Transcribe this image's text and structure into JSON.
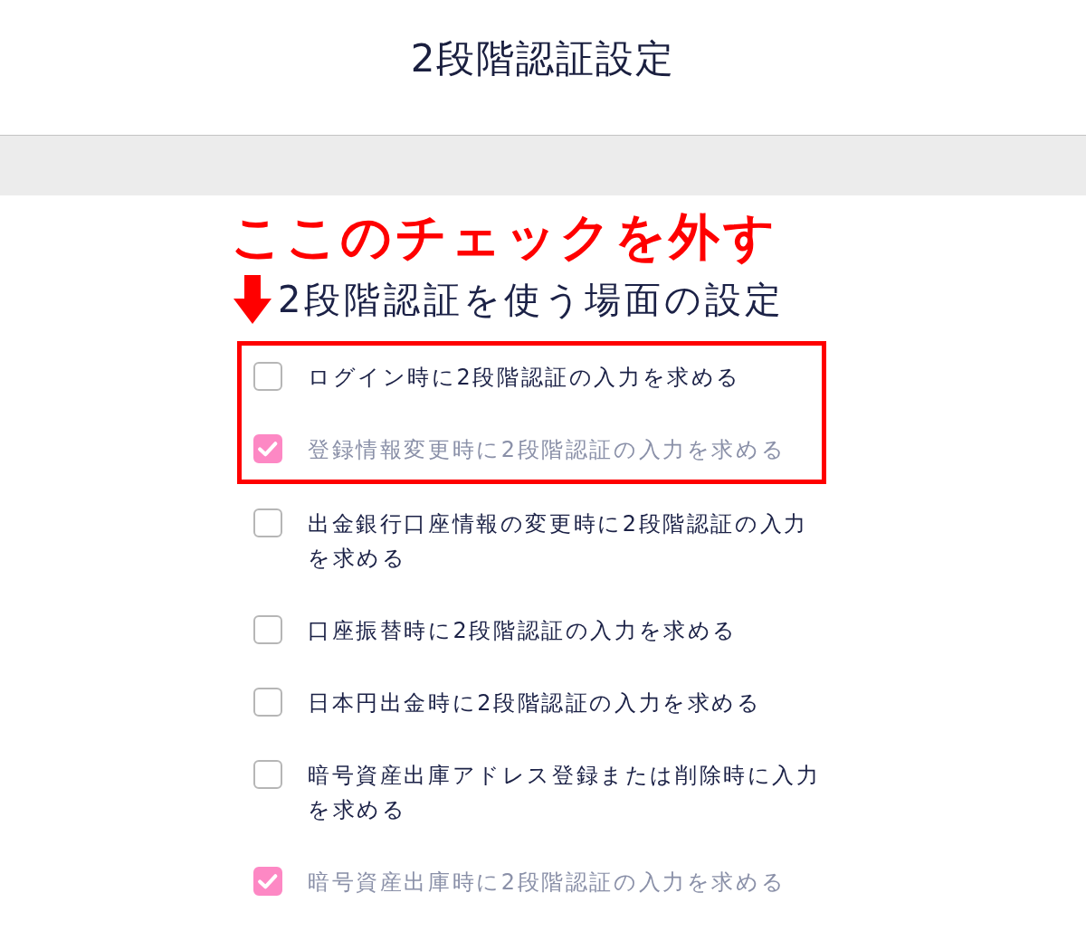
{
  "header": {
    "title": "2段階認証設定"
  },
  "annotation": {
    "text": "ここのチェックを外す"
  },
  "section": {
    "heading": "2段階認証を使う場面の設定",
    "items": [
      {
        "label": "ログイン時に2段階認証の入力を求める",
        "checked": false,
        "highlighted": true
      },
      {
        "label": "登録情報変更時に2段階認証の入力を求める",
        "checked": true,
        "highlighted": true
      },
      {
        "label": "出金銀行口座情報の変更時に2段階認証の入力を求める",
        "checked": false,
        "highlighted": false
      },
      {
        "label": "口座振替時に2段階認証の入力を求める",
        "checked": false,
        "highlighted": false
      },
      {
        "label": "日本円出金時に2段階認証の入力を求める",
        "checked": false,
        "highlighted": false
      },
      {
        "label": "暗号資産出庫アドレス登録または削除時に入力を求める",
        "checked": false,
        "highlighted": false
      },
      {
        "label": "暗号資産出庫時に2段階認証の入力を求める",
        "checked": true,
        "highlighted": false
      }
    ]
  }
}
